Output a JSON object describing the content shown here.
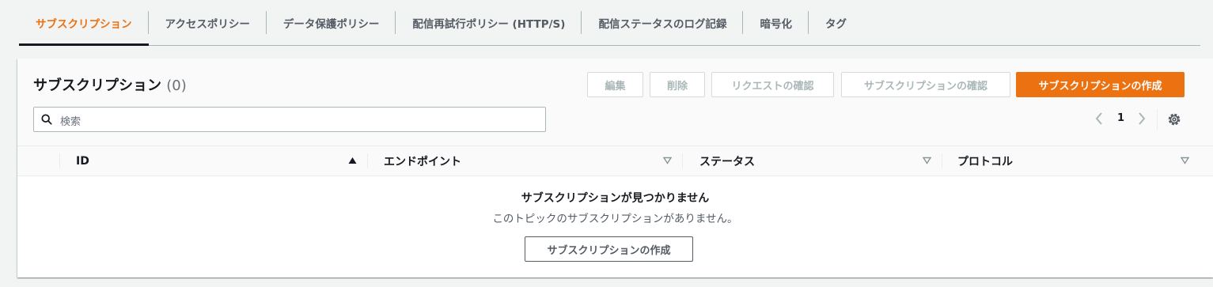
{
  "tabs": [
    {
      "label": "サブスクリプション",
      "active": true
    },
    {
      "label": "アクセスポリシー"
    },
    {
      "label": "データ保護ポリシー"
    },
    {
      "label": "配信再試行ポリシー (HTTP/S)"
    },
    {
      "label": "配信ステータスのログ記録"
    },
    {
      "label": "暗号化"
    },
    {
      "label": "タグ"
    }
  ],
  "panel": {
    "title": "サブスクリプション",
    "count": "(0)",
    "buttons": {
      "edit": "編集",
      "delete": "削除",
      "request_confirm": "リクエストの確認",
      "subscription_confirm": "サブスクリプションの確認",
      "create": "サブスクリプションの作成"
    },
    "search_placeholder": "検索",
    "page_number": "1"
  },
  "table": {
    "columns": [
      "ID",
      "エンドポイント",
      "ステータス",
      "プロトコル"
    ]
  },
  "empty": {
    "title": "サブスクリプションが見つかりません",
    "description": "このトピックのサブスクリプションがありません。",
    "button": "サブスクリプションの作成"
  },
  "colors": {
    "accent": "#ec7211",
    "text": "#16191f",
    "muted": "#687078"
  }
}
